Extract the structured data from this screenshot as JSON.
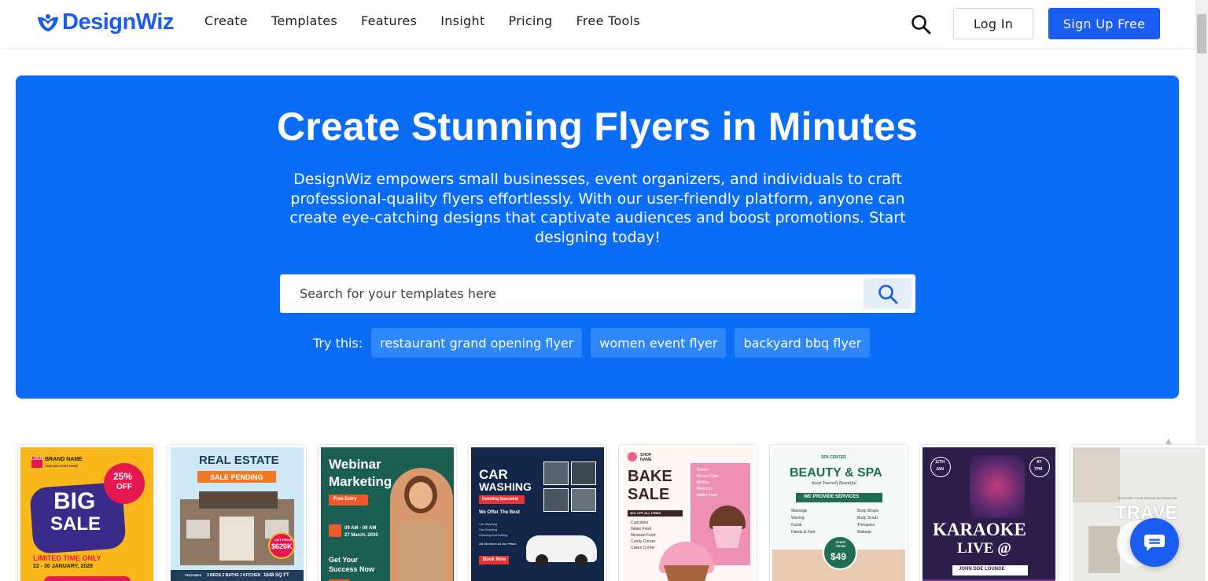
{
  "header": {
    "logo": "DesignWiz",
    "nav": [
      "Create",
      "Templates",
      "Features",
      "Insight",
      "Pricing",
      "Free Tools"
    ],
    "login_label": "Log In",
    "signup_label": "Sign Up Free"
  },
  "hero": {
    "title": "Create Stunning Flyers in Minutes",
    "description": "DesignWiz empowers small businesses, event organizers, and individuals to craft professional-quality flyers effortlessly. With our user-friendly platform, anyone can create eye-catching designs that captivate audiences and boost promotions. Start designing today!",
    "search_placeholder": "Search for your templates here",
    "try_label": "Try this:",
    "suggestions": [
      "restaurant grand opening flyer",
      "women event flyer",
      "backyard bbq flyer"
    ]
  },
  "templates": {
    "t1": {
      "logo": "LOGO",
      "brand": "BRAND NAME",
      "tagline": "TAGLINE GOES HERE",
      "discount": "25%",
      "off": "OFF",
      "big": "BIG",
      "sale": "SALE",
      "limited": "LIMITED TIME ONLY",
      "dates": "22 - 30 JANUARY, 2028"
    },
    "t2": {
      "title": "REAL ESTATE",
      "ribbon": "SALE PENDING",
      "price_label": "LIST PRICE",
      "price": "$620K",
      "features": "FEATURES",
      "rooms": "3 BEDS 2 BATHS 1 KITCHEN",
      "area": "1648 SQ FT"
    },
    "t3": {
      "title1": "Webinar",
      "title2": "Marketing",
      "badge": "Free Entry",
      "time": "09 AM - 09 AM",
      "date": "27 March, 2030",
      "cta1": "Get Your",
      "cta2": "Success Now"
    },
    "t4": {
      "title1": "CAR",
      "title2": "WASHING",
      "badge": "Detailing Specialist",
      "offer": "We Offer The Best",
      "services": [
        "Car Washing",
        "Car Detailing",
        "Rubbing And Buffing"
      ],
      "note": "All Services At Our Place",
      "cta": "Book Now"
    },
    "t5": {
      "shop": "SHOP NAME",
      "bake": "BAKE",
      "sale": "SALE",
      "offer": "40% OFF ALL ITEMS",
      "menu_right": [
        "Starter",
        "Mouse Cake",
        "Muffins",
        "Mexican",
        "Italian Food"
      ],
      "menu_left": [
        "Cupcakes",
        "Italian Food",
        "Mexican Food",
        "Candy Corner",
        "Cakes Corner"
      ]
    },
    "t6": {
      "center": "SPA CENTER",
      "title": "BEAUTY & SPA",
      "script": "Keep Yourself Beautiful",
      "ribbon": "WE PROVIDE SERVICES",
      "left": [
        "Massage",
        "Waxing",
        "Facial",
        "Hands & Feet"
      ],
      "right": [
        "Body Wraps",
        "Body Scrub",
        "Therapies",
        "Makeup"
      ],
      "start": "START FROM",
      "price": "$49"
    },
    "t7": {
      "date1": "11TH",
      "date2": "JAN",
      "time1": "AT",
      "time2": "7PM",
      "title1": "KARAOKE",
      "title2": "LIVE @",
      "venue": "JOHN DOE LOUNGE"
    },
    "t8": {
      "top": "EXPLORE YOUR DREAM DESTINATION",
      "title": "TRAVE"
    }
  },
  "colors": {
    "brand": "#1a5cf0",
    "hero": "#0b6df5",
    "chip": "#2f86f8"
  }
}
